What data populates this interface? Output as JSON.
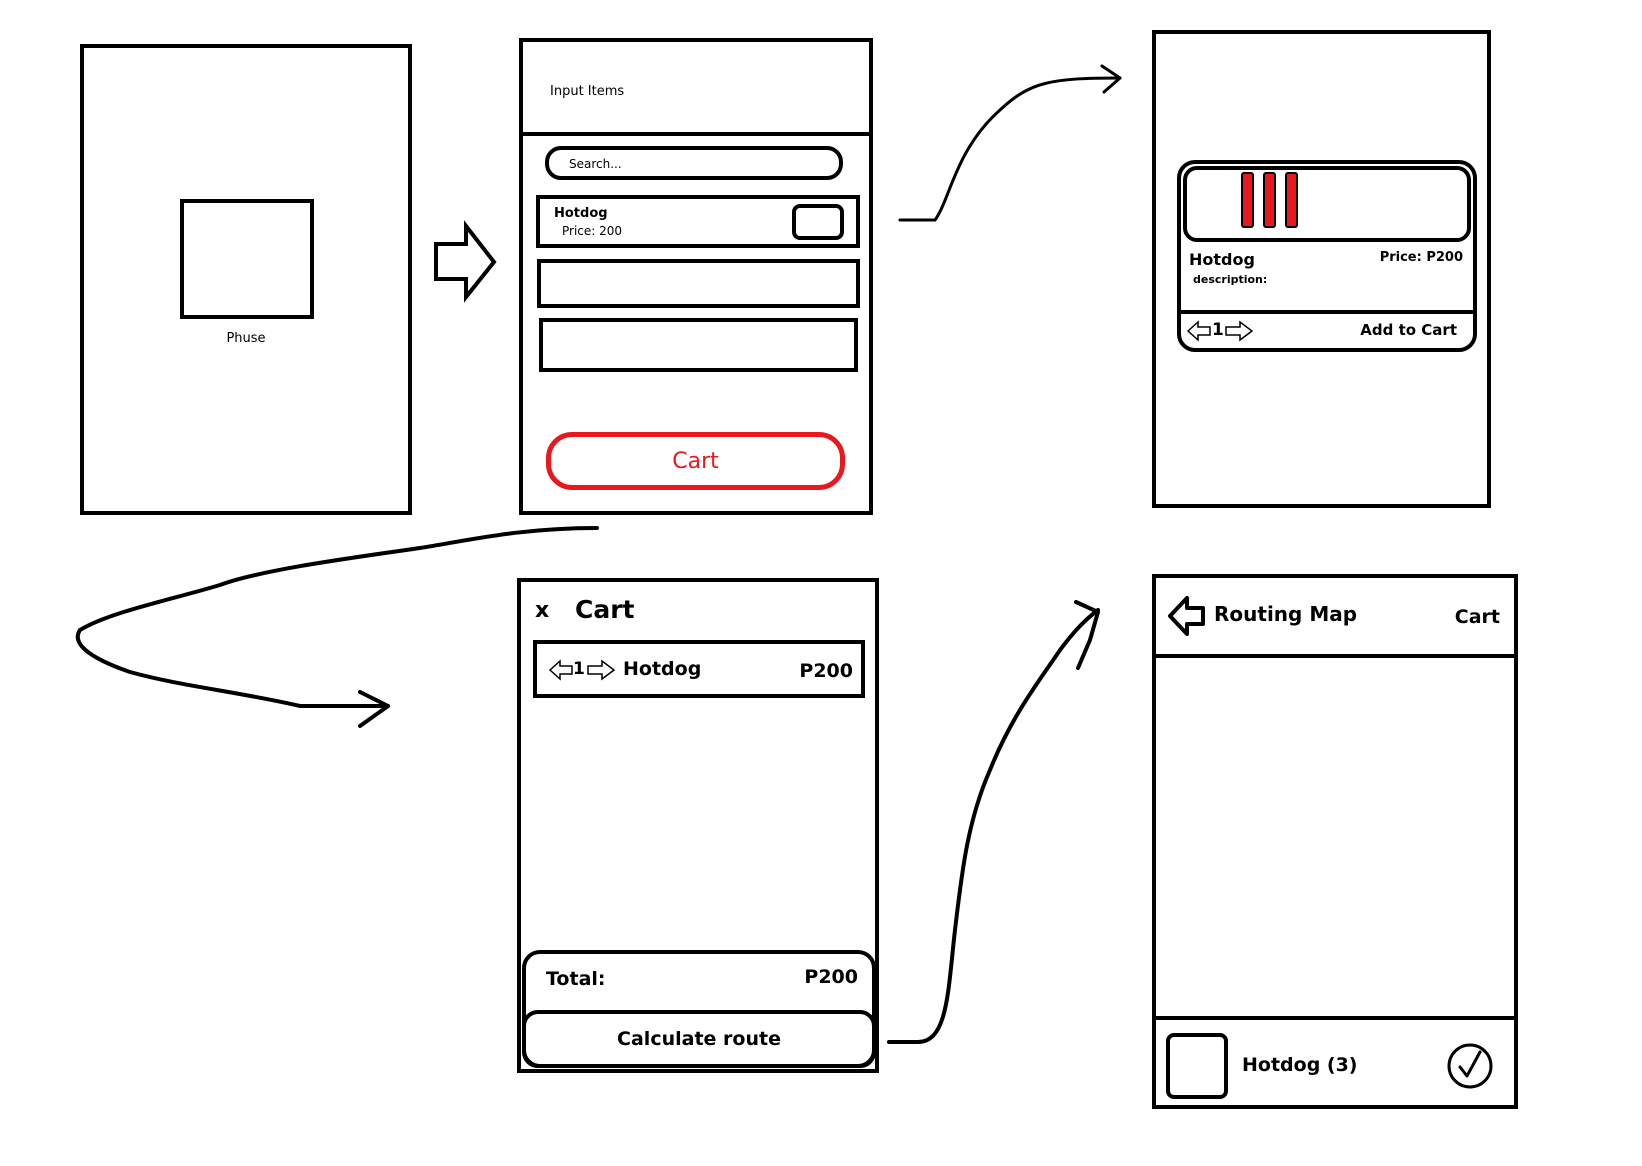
{
  "colors": {
    "ink": "#000000",
    "accent": "#e8181d",
    "background": "#ffffff"
  },
  "splash": {
    "label": "Phuse",
    "logo_icon": "square-logo-icon"
  },
  "input_items": {
    "title": "Input Items",
    "search_placeholder": "Search...",
    "items": [
      {
        "name": "Hotdog",
        "price": "Price: 200"
      },
      {
        "name": "",
        "price": ""
      },
      {
        "name": "",
        "price": ""
      }
    ],
    "cart_button": "Cart"
  },
  "item_detail": {
    "name": "Hotdog",
    "price": "Price: P200",
    "description": "description:",
    "quantity": "1",
    "add_to_cart": "Add to Cart",
    "image_icon": "hotdog-image-icon"
  },
  "cart": {
    "close": "x",
    "title": "Cart",
    "items": [
      {
        "quantity": "1",
        "name": "Hotdog",
        "price": "P200"
      }
    ],
    "total_label": "Total:",
    "total_value": "P200",
    "calculate_button": "Calculate route"
  },
  "routing_map": {
    "back_icon": "back-arrow-icon",
    "title": "Routing Map",
    "cart_link": "Cart",
    "item_label": "Hotdog (3)",
    "check_icon": "checkmark-circle-icon"
  },
  "flow_arrows": [
    "arrow-splash-to-input",
    "arrow-input-to-detail",
    "arrow-input-to-cart",
    "arrow-cart-to-map"
  ]
}
